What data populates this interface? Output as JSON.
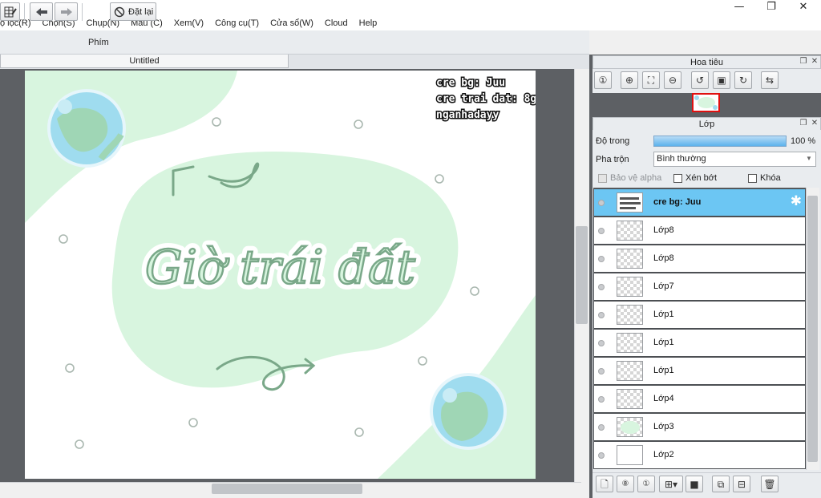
{
  "window": {
    "minimize": "—",
    "maximize": "❐",
    "close": "✕"
  },
  "menu": [
    "ộ lọc(R)",
    "Chọn(S)",
    "Chụp(N)",
    "Màu (C)",
    "Xem(V)",
    "Công cụ(T)",
    "Cửa sổ(W)",
    "Cloud",
    "Help"
  ],
  "toolbar": {
    "phim_label": "Phím",
    "reset_label": "Đặt lại"
  },
  "document": {
    "tab_title": "Untitled"
  },
  "artwork": {
    "credit_lines": [
      "cre bg: Juu",
      "cre trai dat: 8g",
      "nganhadayy"
    ],
    "title_text": "Giờ trái đất",
    "colors": {
      "blob": "#d8f5df",
      "letter": "#7aa889",
      "dots": "#a9b7af"
    }
  },
  "navigator": {
    "title": "Hoa tiêu"
  },
  "layers_panel": {
    "title": "Lớp",
    "opacity_label": "Độ trong",
    "opacity_value": "100 %",
    "opacity_fraction": 1.0,
    "blend_label": "Pha trộn",
    "blend_value": "Bình thường",
    "protect_alpha_label": "Bảo vệ alpha",
    "clip_label": "Xén bớt",
    "lock_label": "Khóa",
    "layers": [
      {
        "name": "cre bg: Juu",
        "selected": true,
        "thumb": "text"
      },
      {
        "name": "Lớp8",
        "selected": false,
        "thumb": "transparent"
      },
      {
        "name": "Lớp8",
        "selected": false,
        "thumb": "transparent"
      },
      {
        "name": "Lớp7",
        "selected": false,
        "thumb": "transparent"
      },
      {
        "name": "Lớp1",
        "selected": false,
        "thumb": "transparent"
      },
      {
        "name": "Lớp1",
        "selected": false,
        "thumb": "transparent"
      },
      {
        "name": "Lớp1",
        "selected": false,
        "thumb": "transparent"
      },
      {
        "name": "Lớp4",
        "selected": false,
        "thumb": "transparent"
      },
      {
        "name": "Lớp3",
        "selected": false,
        "thumb": "green"
      },
      {
        "name": "Lớp2",
        "selected": false,
        "thumb": "plain"
      }
    ]
  },
  "accent": "#6cc6f3"
}
